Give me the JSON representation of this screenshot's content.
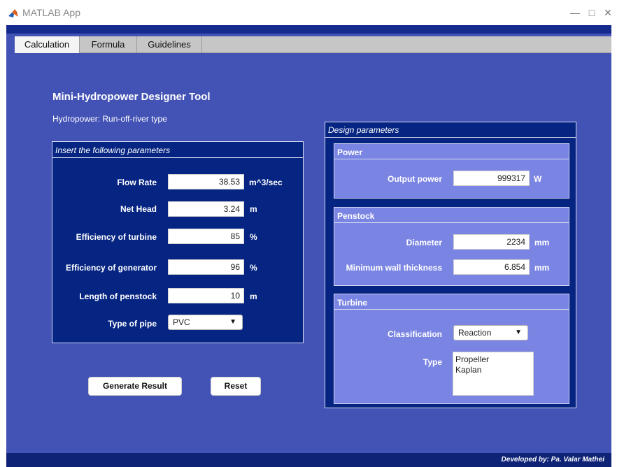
{
  "window": {
    "title": "MATLAB App"
  },
  "tabs": [
    {
      "label": "Calculation",
      "active": true
    },
    {
      "label": "Formula",
      "active": false
    },
    {
      "label": "Guidelines",
      "active": false
    }
  ],
  "header": {
    "title": "Mini-Hydropower Designer Tool",
    "subtitle": "Hydropower: Run-off-river type"
  },
  "inputs": {
    "title": "Insert the following parameters",
    "flow_rate": {
      "label": "Flow Rate",
      "value": "38.53",
      "unit": "m^3/sec"
    },
    "net_head": {
      "label": "Net Head",
      "value": "3.24",
      "unit": "m"
    },
    "eff_turbine": {
      "label": "Efficiency of turbine",
      "value": "85",
      "unit": "%"
    },
    "eff_generator": {
      "label": "Efficiency of generator",
      "value": "96",
      "unit": "%"
    },
    "penstock_length": {
      "label": "Length of penstock",
      "value": "10",
      "unit": "m"
    },
    "pipe_type": {
      "label": "Type of pipe",
      "value": "PVC"
    }
  },
  "buttons": {
    "generate": "Generate Result",
    "reset": "Reset"
  },
  "design": {
    "title": "Design parameters",
    "power": {
      "title": "Power",
      "output": {
        "label": "Output power",
        "value": "999317",
        "unit": "W"
      }
    },
    "penstock": {
      "title": "Penstock",
      "diameter": {
        "label": "Diameter",
        "value": "2234",
        "unit": "mm"
      },
      "wall": {
        "label": "Minimum wall thickness",
        "value": "6.854",
        "unit": "mm"
      }
    },
    "turbine": {
      "title": "Turbine",
      "classification": {
        "label": "Classification",
        "value": "Reaction"
      },
      "type": {
        "label": "Type",
        "items": [
          "Propeller",
          "Kaplan"
        ]
      }
    }
  },
  "footer": "Developed by: Pa. Valar Mathei",
  "colors": {
    "background": "#4353b5",
    "panel": "#062582",
    "subpanel": "#7a85e3",
    "accent_dark": "#0e2276"
  },
  "icons": {
    "app": "matlab-icon",
    "dropdown": "caret-down-icon",
    "minimize": "minimize-icon",
    "maximize": "maximize-icon",
    "close": "close-icon"
  }
}
